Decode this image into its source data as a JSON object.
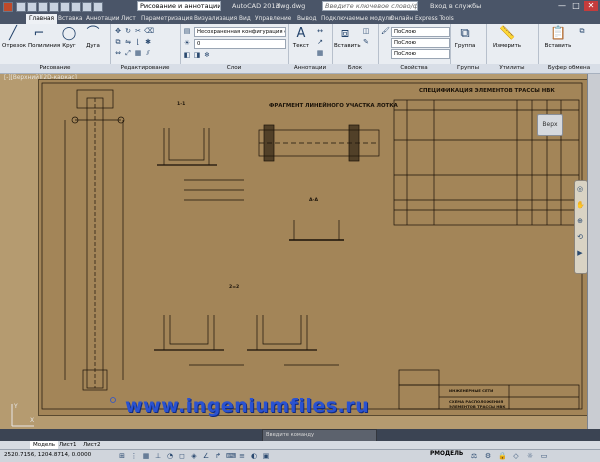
{
  "window": {
    "workspace": "Рисование и аннотации",
    "title": "AutoCAD 2013",
    "filename": "dwg.dwg",
    "search_placeholder": "Введите ключевое слово/фразу",
    "signin": "Вход в службы",
    "controls": [
      "—",
      "□",
      "✕"
    ]
  },
  "tabs": [
    {
      "label": "Главная",
      "active": true
    },
    {
      "label": "Вставка"
    },
    {
      "label": "Аннотации"
    },
    {
      "label": "Лист"
    },
    {
      "label": "Параметризация"
    },
    {
      "label": "Визуализация"
    },
    {
      "label": "Вид"
    },
    {
      "label": "Управление"
    },
    {
      "label": "Вывод"
    },
    {
      "label": "Подключаемые модули"
    },
    {
      "label": "Онлайн"
    },
    {
      "label": "Express Tools"
    }
  ],
  "ribbon": {
    "draw": {
      "label": "Рисование",
      "buttons": [
        "Отрезок",
        "Полилиния",
        "Круг",
        "Дуга"
      ]
    },
    "modify": {
      "label": "Редактирование"
    },
    "layers": {
      "label": "Слои",
      "current_state": "Несохраненная конфигурация сло",
      "current_layer": "0"
    },
    "annotation": {
      "label": "Аннотации",
      "buttons": [
        "Текст"
      ]
    },
    "block": {
      "label": "Блок",
      "buttons": [
        "Вставить"
      ]
    },
    "properties": {
      "label": "Свойства",
      "color": "ПоСлою",
      "linetype": "ПоСлою",
      "lineweight": "ПоСлою"
    },
    "groups": {
      "label": "Группы",
      "buttons": [
        "Группа"
      ]
    },
    "utilities": {
      "label": "Утилиты",
      "buttons": [
        "Измерить"
      ]
    },
    "clipboard": {
      "label": "Буфер обмена",
      "buttons": [
        "Вставить"
      ]
    }
  },
  "viewport": {
    "view_label": "[-][Верхний][2D-каркас]",
    "viewcube_label": "Верх"
  },
  "drawing": {
    "title_fragment": "ФРАГМЕНТ ЛИНЕЙНОГО УЧАСТКА ЛОТКА",
    "title_spec": "СПЕЦИФИКАЦИЯ ЭЛЕМЕНТОВ ТРАССЫ НВК",
    "section_1": "1-1",
    "section_aa": "А-А",
    "section_2": "2=2",
    "stamp_line1": "ИНЖЕНЕРНЫЕ СЕТИ",
    "stamp_line2": "СХЕМА РАСПОЛОЖЕНИЯ",
    "stamp_line3": "ЭЛЕМЕНТОВ ТРАССЫ НВК"
  },
  "command_line": {
    "placeholder": "Введите команду"
  },
  "layout_tabs": [
    "Модель",
    "Лист1",
    "Лист2"
  ],
  "status": {
    "coords": "2520.7156, 1204.8714, 0.0000",
    "mode": "РМОДЕЛЬ"
  },
  "watermark": "www.ingeniumfiles.ru",
  "colors": {
    "background": "#b59b70",
    "sheet": "#a38558",
    "ribbon": "#e9edf2",
    "titlebar": "#4a5568",
    "watermark": "#2a52d0"
  }
}
